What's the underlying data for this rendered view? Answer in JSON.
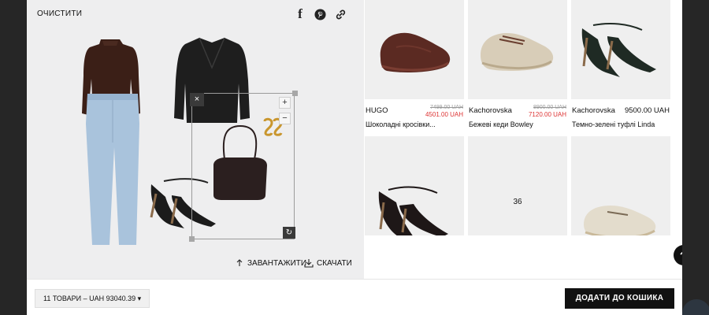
{
  "toolbar": {
    "clear_label": "ОЧИСТИТИ"
  },
  "share": {
    "facebook": "facebook-icon",
    "pinterest": "pinterest-icon",
    "link": "link-icon"
  },
  "canvas": {
    "zoom_in": "+",
    "zoom_out": "−",
    "delete": "×",
    "rotate": "↻"
  },
  "actions": {
    "upload_label": "ЗАВАНТАЖИТИ",
    "download_label": "СКАЧАТИ"
  },
  "products": [
    {
      "brand": "HUGO",
      "name": "Шоколадні кросівки...",
      "old_price": "7499.00 UAH",
      "price": "4501.00 UAH"
    },
    {
      "brand": "Kachorovska",
      "name": "Бежеві кеди Bowley",
      "old_price": "8900.00 UAH",
      "price": "7120.00 UAH"
    },
    {
      "brand": "Kachorovska",
      "name": "Темно-зелені туфлі Linda",
      "price": "9500.00 UAH"
    },
    {
      "count": "36"
    }
  ],
  "summary": {
    "label": "11 ТОВАРИ – UAH 93040.39 ▾"
  },
  "cart": {
    "add_label": "ДОДАТИ ДО КОШИКА"
  },
  "colors": {
    "sale": "#d33333",
    "primary": "#111111",
    "canvas_bg": "#eeeeef"
  }
}
